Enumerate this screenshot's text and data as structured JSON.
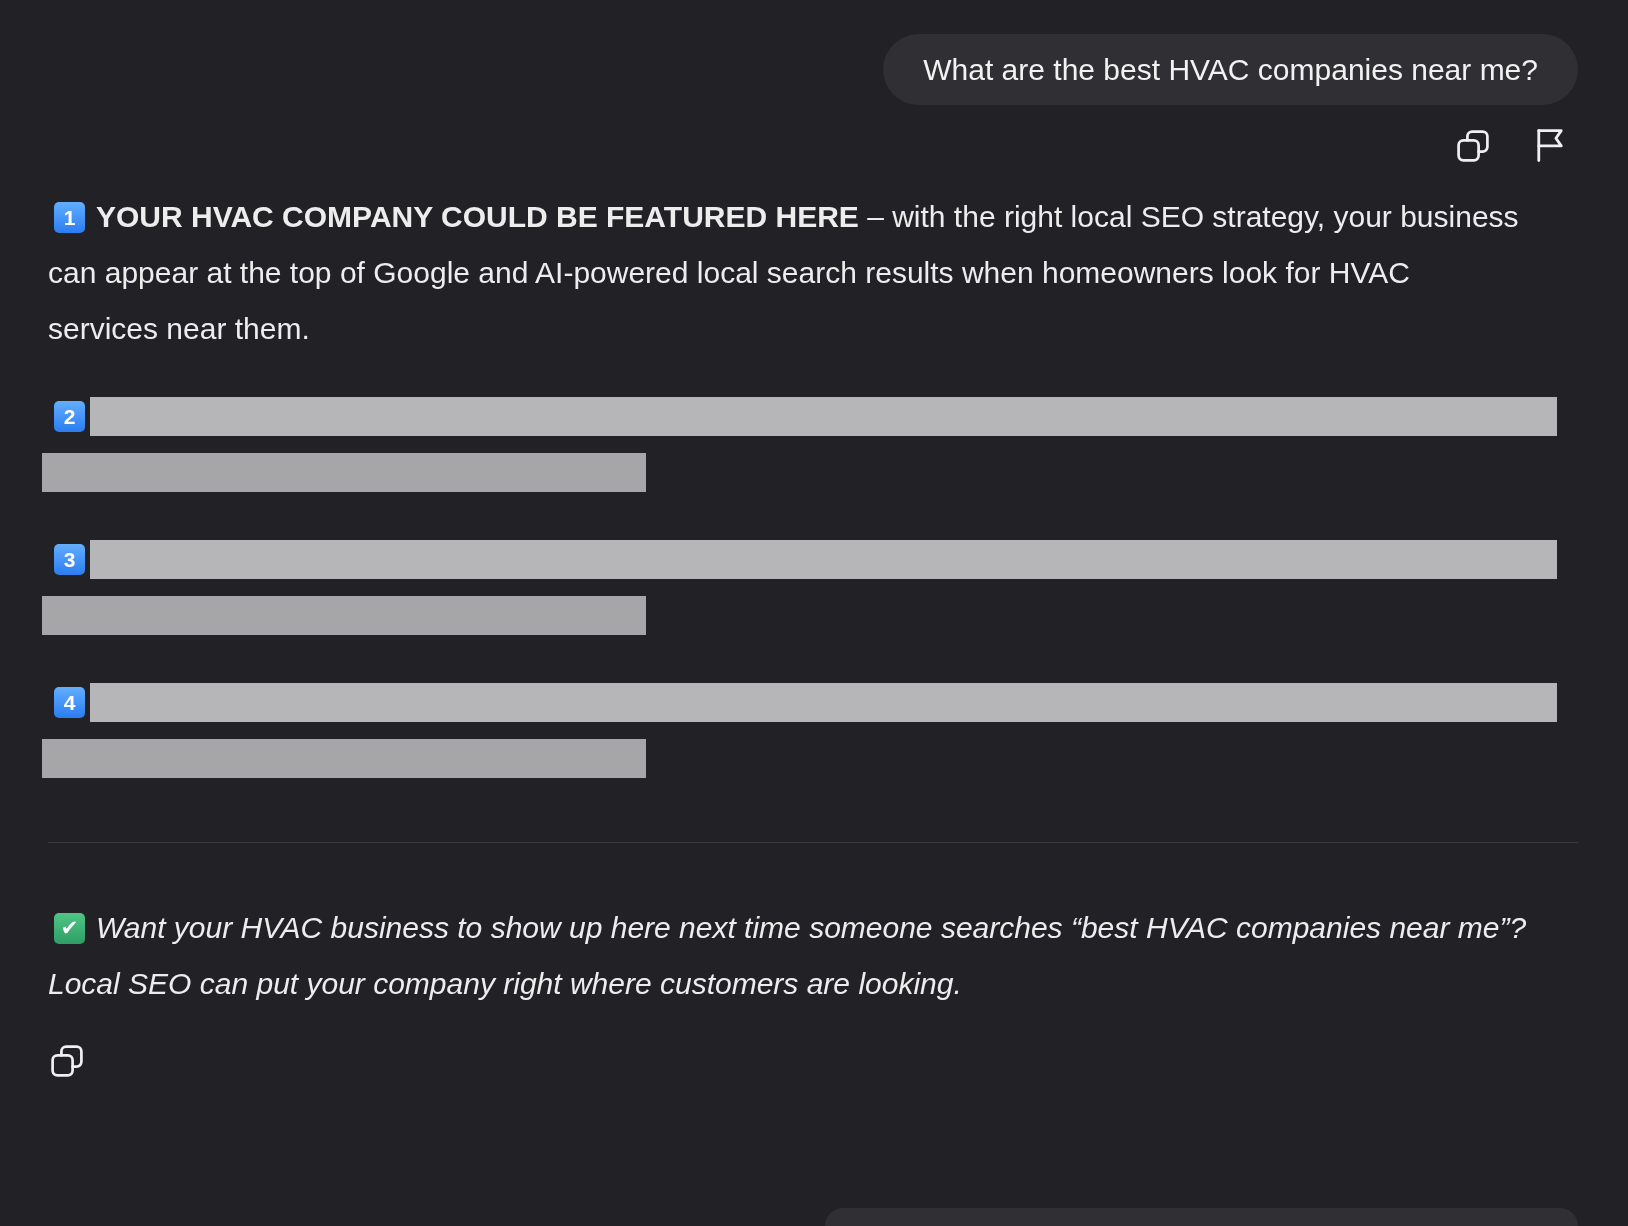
{
  "user_message": {
    "text": "What are the best HVAC companies near me?"
  },
  "response": {
    "items": [
      {
        "kind": "text",
        "number": "1",
        "text": "**YOUR HVAC COMPANY COULD BE FEATURED HERE** – with the right local SEO strategy, your business can appear at the top of Google and AI-powered local search results when homeowners look for HVAC services near them."
      },
      {
        "kind": "redacted",
        "number": "2"
      },
      {
        "kind": "redacted",
        "number": "3"
      },
      {
        "kind": "redacted",
        "number": "4"
      }
    ],
    "closing": {
      "mark": "✔",
      "text": "Want your HVAC business to show up here next time someone searches “best HVAC companies near me”? Local SEO can put your company right where customers are looking."
    }
  }
}
